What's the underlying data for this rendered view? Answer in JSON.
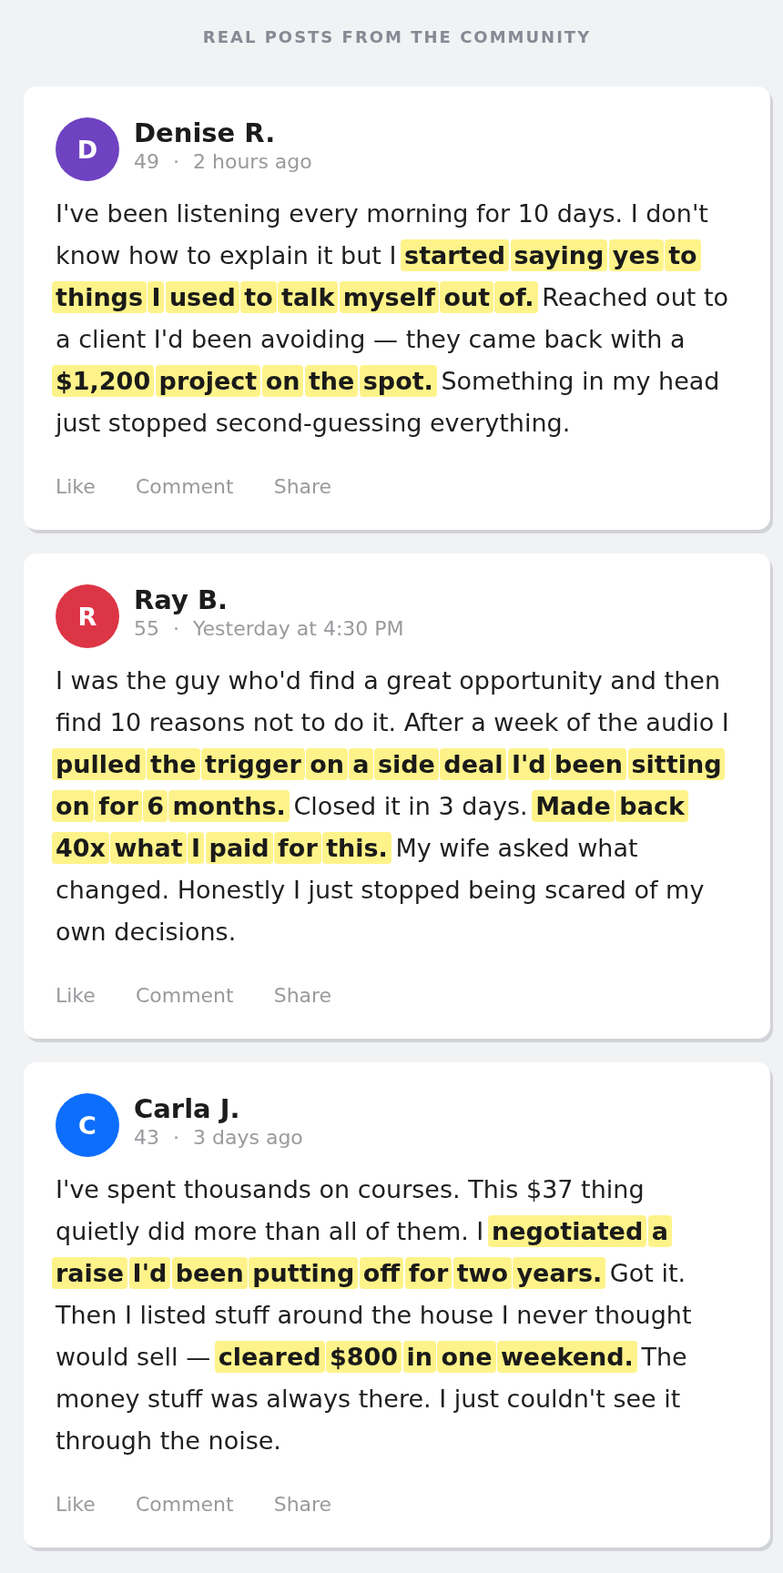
{
  "heading": "REAL POSTS FROM THE COMMUNITY",
  "posts": [
    {
      "initial": "D",
      "color": "#6f42c1",
      "author": "Denise R.",
      "number": "49",
      "separator": "·",
      "time": "2 hours ago",
      "text": "I've been listening every morning for 10 days. I don't know how to explain it but I **started saying yes to things I used to talk myself out of.** Reached out to a client I'd been avoiding — they came back with a **$1,200 project on the spot.** Something in my head just stopped second-guessing everything.",
      "actions": [
        "Like",
        "Comment",
        "Share"
      ]
    },
    {
      "initial": "R",
      "color": "#dc3545",
      "author": "Ray B.",
      "number": "55",
      "separator": "·",
      "time": "Yesterday at 4:30 PM",
      "text": "I was the guy who'd find a great opportunity and then find 10 reasons not to do it. After a week of the audio I **pulled the trigger on a side deal I'd been sitting on for 6 months.** Closed it in 3 days. **Made back 40x what I paid for this.** My wife asked what changed. Honestly I just stopped being scared of my own decisions.",
      "actions": [
        "Like",
        "Comment",
        "Share"
      ]
    },
    {
      "initial": "C",
      "color": "#0d6efd",
      "author": "Carla J.",
      "number": "43",
      "separator": "·",
      "time": "3 days ago",
      "text": "I've spent thousands on courses. This $37 thing quietly did more than all of them. I **negotiated a raise I'd been putting off for two years.** Got it. Then I listed stuff around the house I never thought would sell — **cleared $800 in one weekend.** The money stuff was always there. I just couldn't see it through the noise.",
      "actions": [
        "Like",
        "Comment",
        "Share"
      ]
    }
  ]
}
